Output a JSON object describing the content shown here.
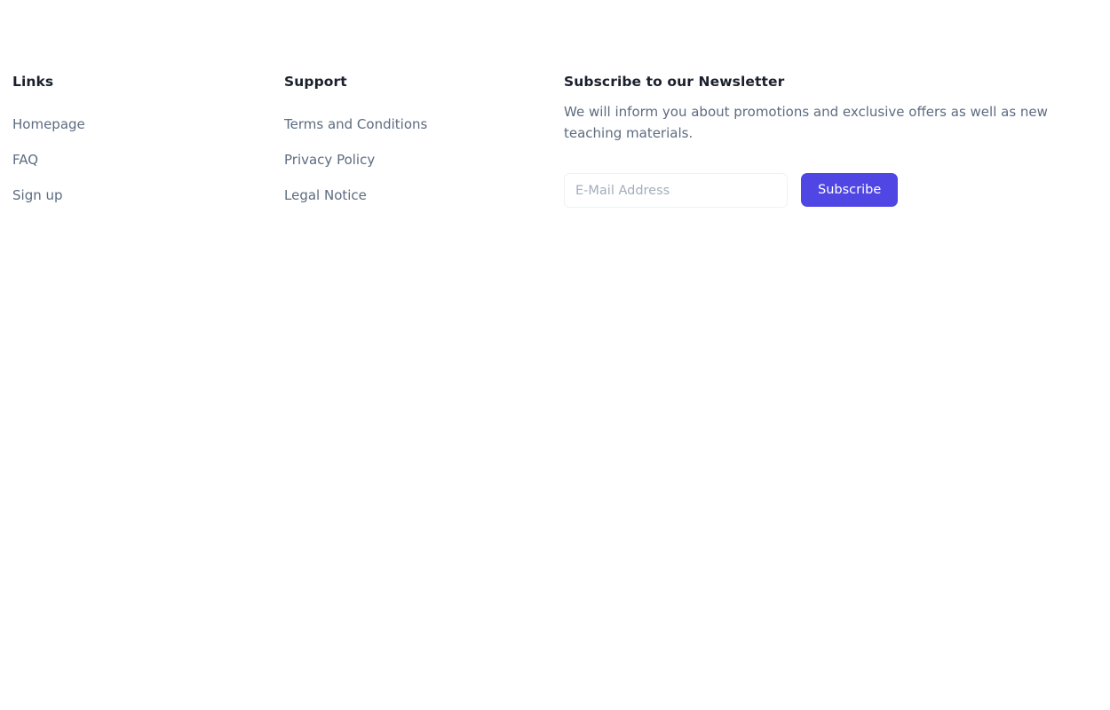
{
  "footer": {
    "links_column": {
      "heading": "Links",
      "items": [
        {
          "label": "Homepage"
        },
        {
          "label": "FAQ"
        },
        {
          "label": "Sign up"
        }
      ]
    },
    "support_column": {
      "heading": "Support",
      "items": [
        {
          "label": "Terms and Conditions"
        },
        {
          "label": "Privacy Policy"
        },
        {
          "label": "Legal Notice"
        }
      ]
    },
    "newsletter": {
      "heading": "Subscribe to our Newsletter",
      "description": "We will inform you about promotions and exclusive offers as well as new teaching materials.",
      "email_value": "",
      "email_placeholder": "E-Mail Address",
      "subscribe_label": "Subscribe"
    }
  },
  "colors": {
    "accent": "#5046e4",
    "heading": "#1a202c",
    "body_text": "#5d6b80",
    "placeholder": "#a3adbb",
    "input_border": "#f0f1f4",
    "page_background": "#ffffff"
  }
}
